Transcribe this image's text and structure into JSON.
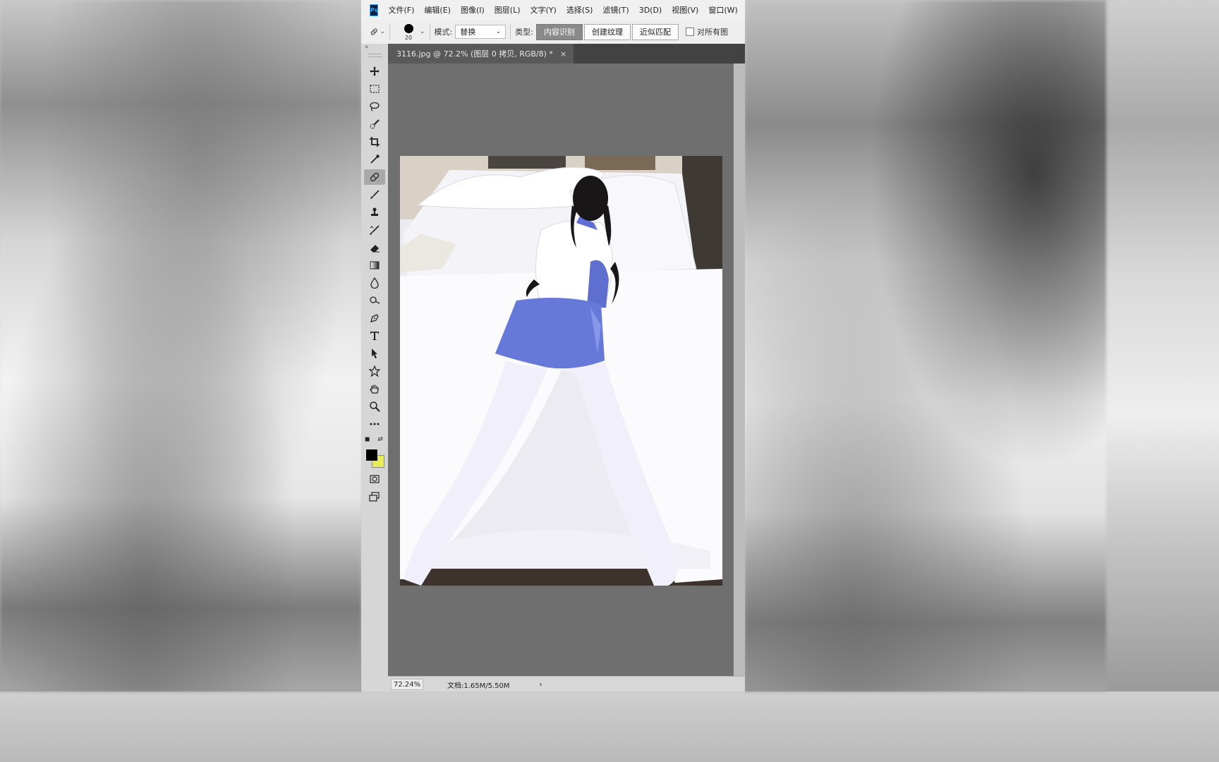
{
  "app": {
    "logo": "Ps",
    "menu": [
      "文件(F)",
      "编辑(E)",
      "图像(I)",
      "图层(L)",
      "文字(Y)",
      "选择(S)",
      "滤镜(T)",
      "3D(D)",
      "视图(V)",
      "窗口(W)"
    ]
  },
  "options": {
    "tool_icon": "spot-healing-brush-icon",
    "brush_size": "20",
    "mode_label": "模式:",
    "mode_value": "替换",
    "type_label": "类型:",
    "type_buttons": [
      "内容识别",
      "创建纹理",
      "近似匹配"
    ],
    "type_selected": "内容识别",
    "sample_all_label": "对所有图"
  },
  "tools": [
    "move-icon",
    "rectangular-marquee-icon",
    "lasso-icon",
    "quick-selection-icon",
    "crop-icon",
    "eyedropper-icon",
    "spot-healing-brush-icon",
    "brush-icon",
    "clone-stamp-icon",
    "history-brush-icon",
    "eraser-icon",
    "gradient-icon",
    "blur-icon",
    "dodge-icon",
    "pen-icon",
    "type-icon",
    "path-selection-icon",
    "custom-shape-icon",
    "hand-icon",
    "zoom-icon",
    "edit-toolbar-icon"
  ],
  "colors": {
    "foreground": "#000000",
    "background": "#e8ec5a",
    "active_tool": "spot-healing-brush-icon"
  },
  "document": {
    "tab_title": "3116.jpg @ 72.2% (图层 0 拷贝, RGB/8) *",
    "close": "×"
  },
  "status": {
    "zoom": "72.24%",
    "doc_info": "文档:1.65M/5.50M",
    "arrow": "›"
  }
}
